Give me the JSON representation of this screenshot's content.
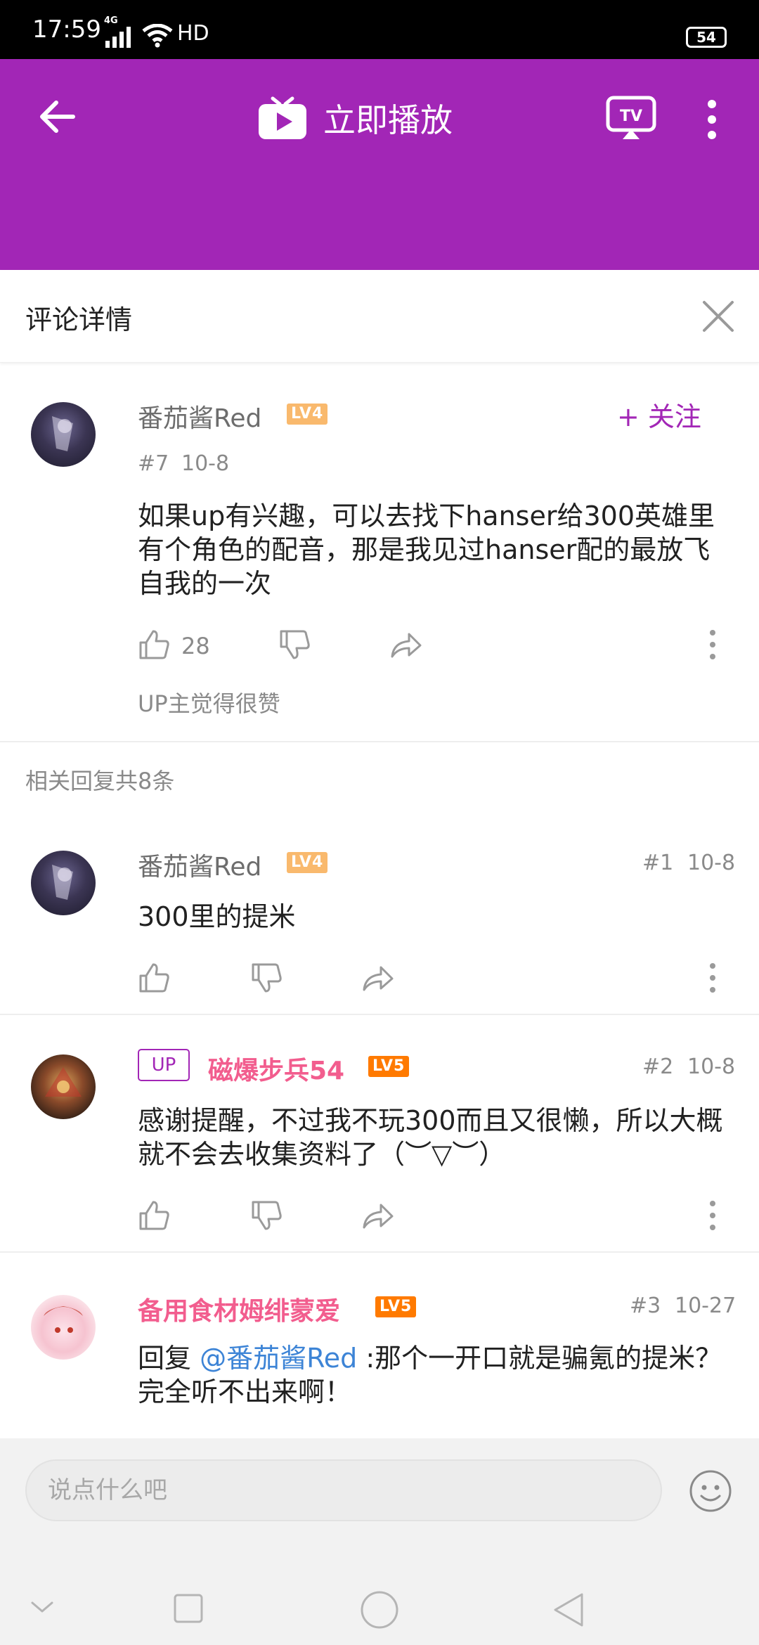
{
  "status": {
    "time": "17:59",
    "network": "4G",
    "hd": "HD",
    "battery": "54"
  },
  "header": {
    "play_label": "立即播放",
    "accent_color": "#a226b6"
  },
  "detail": {
    "title": "评论详情"
  },
  "main_comment": {
    "user": "番茄酱Red",
    "level": "LV4",
    "follow": "+ 关注",
    "floor": "#7",
    "date": "10-8",
    "text": "如果up有兴趣，可以去找下hanser给300英雄里有个角色的配音，那是我见过hanser配的最放飞自我的一次",
    "likes": "28",
    "up_liked": "UP主觉得很赞"
  },
  "replies_count": "相关回复共8条",
  "replies": [
    {
      "user": "番茄酱Red",
      "level": "LV4",
      "floor": "#1",
      "date": "10-8",
      "text": "300里的提米"
    },
    {
      "badge": "UP",
      "user": "磁爆步兵54",
      "level": "LV5",
      "floor": "#2",
      "date": "10-8",
      "text": "感谢提醒，不过我不玩300而且又很懒，所以大概就不会去收集资料了（︶▽︶）"
    },
    {
      "user": "备用食材姆绯蒙爱",
      "level": "LV5",
      "floor": "#3",
      "date": "10-27",
      "text_prefix": "回复 ",
      "mention": "@番茄酱Red",
      "text_suffix": " :那个一开口就是骗氪的提米？完全听不出来啊！"
    }
  ],
  "composer": {
    "placeholder": "说点什么吧"
  }
}
